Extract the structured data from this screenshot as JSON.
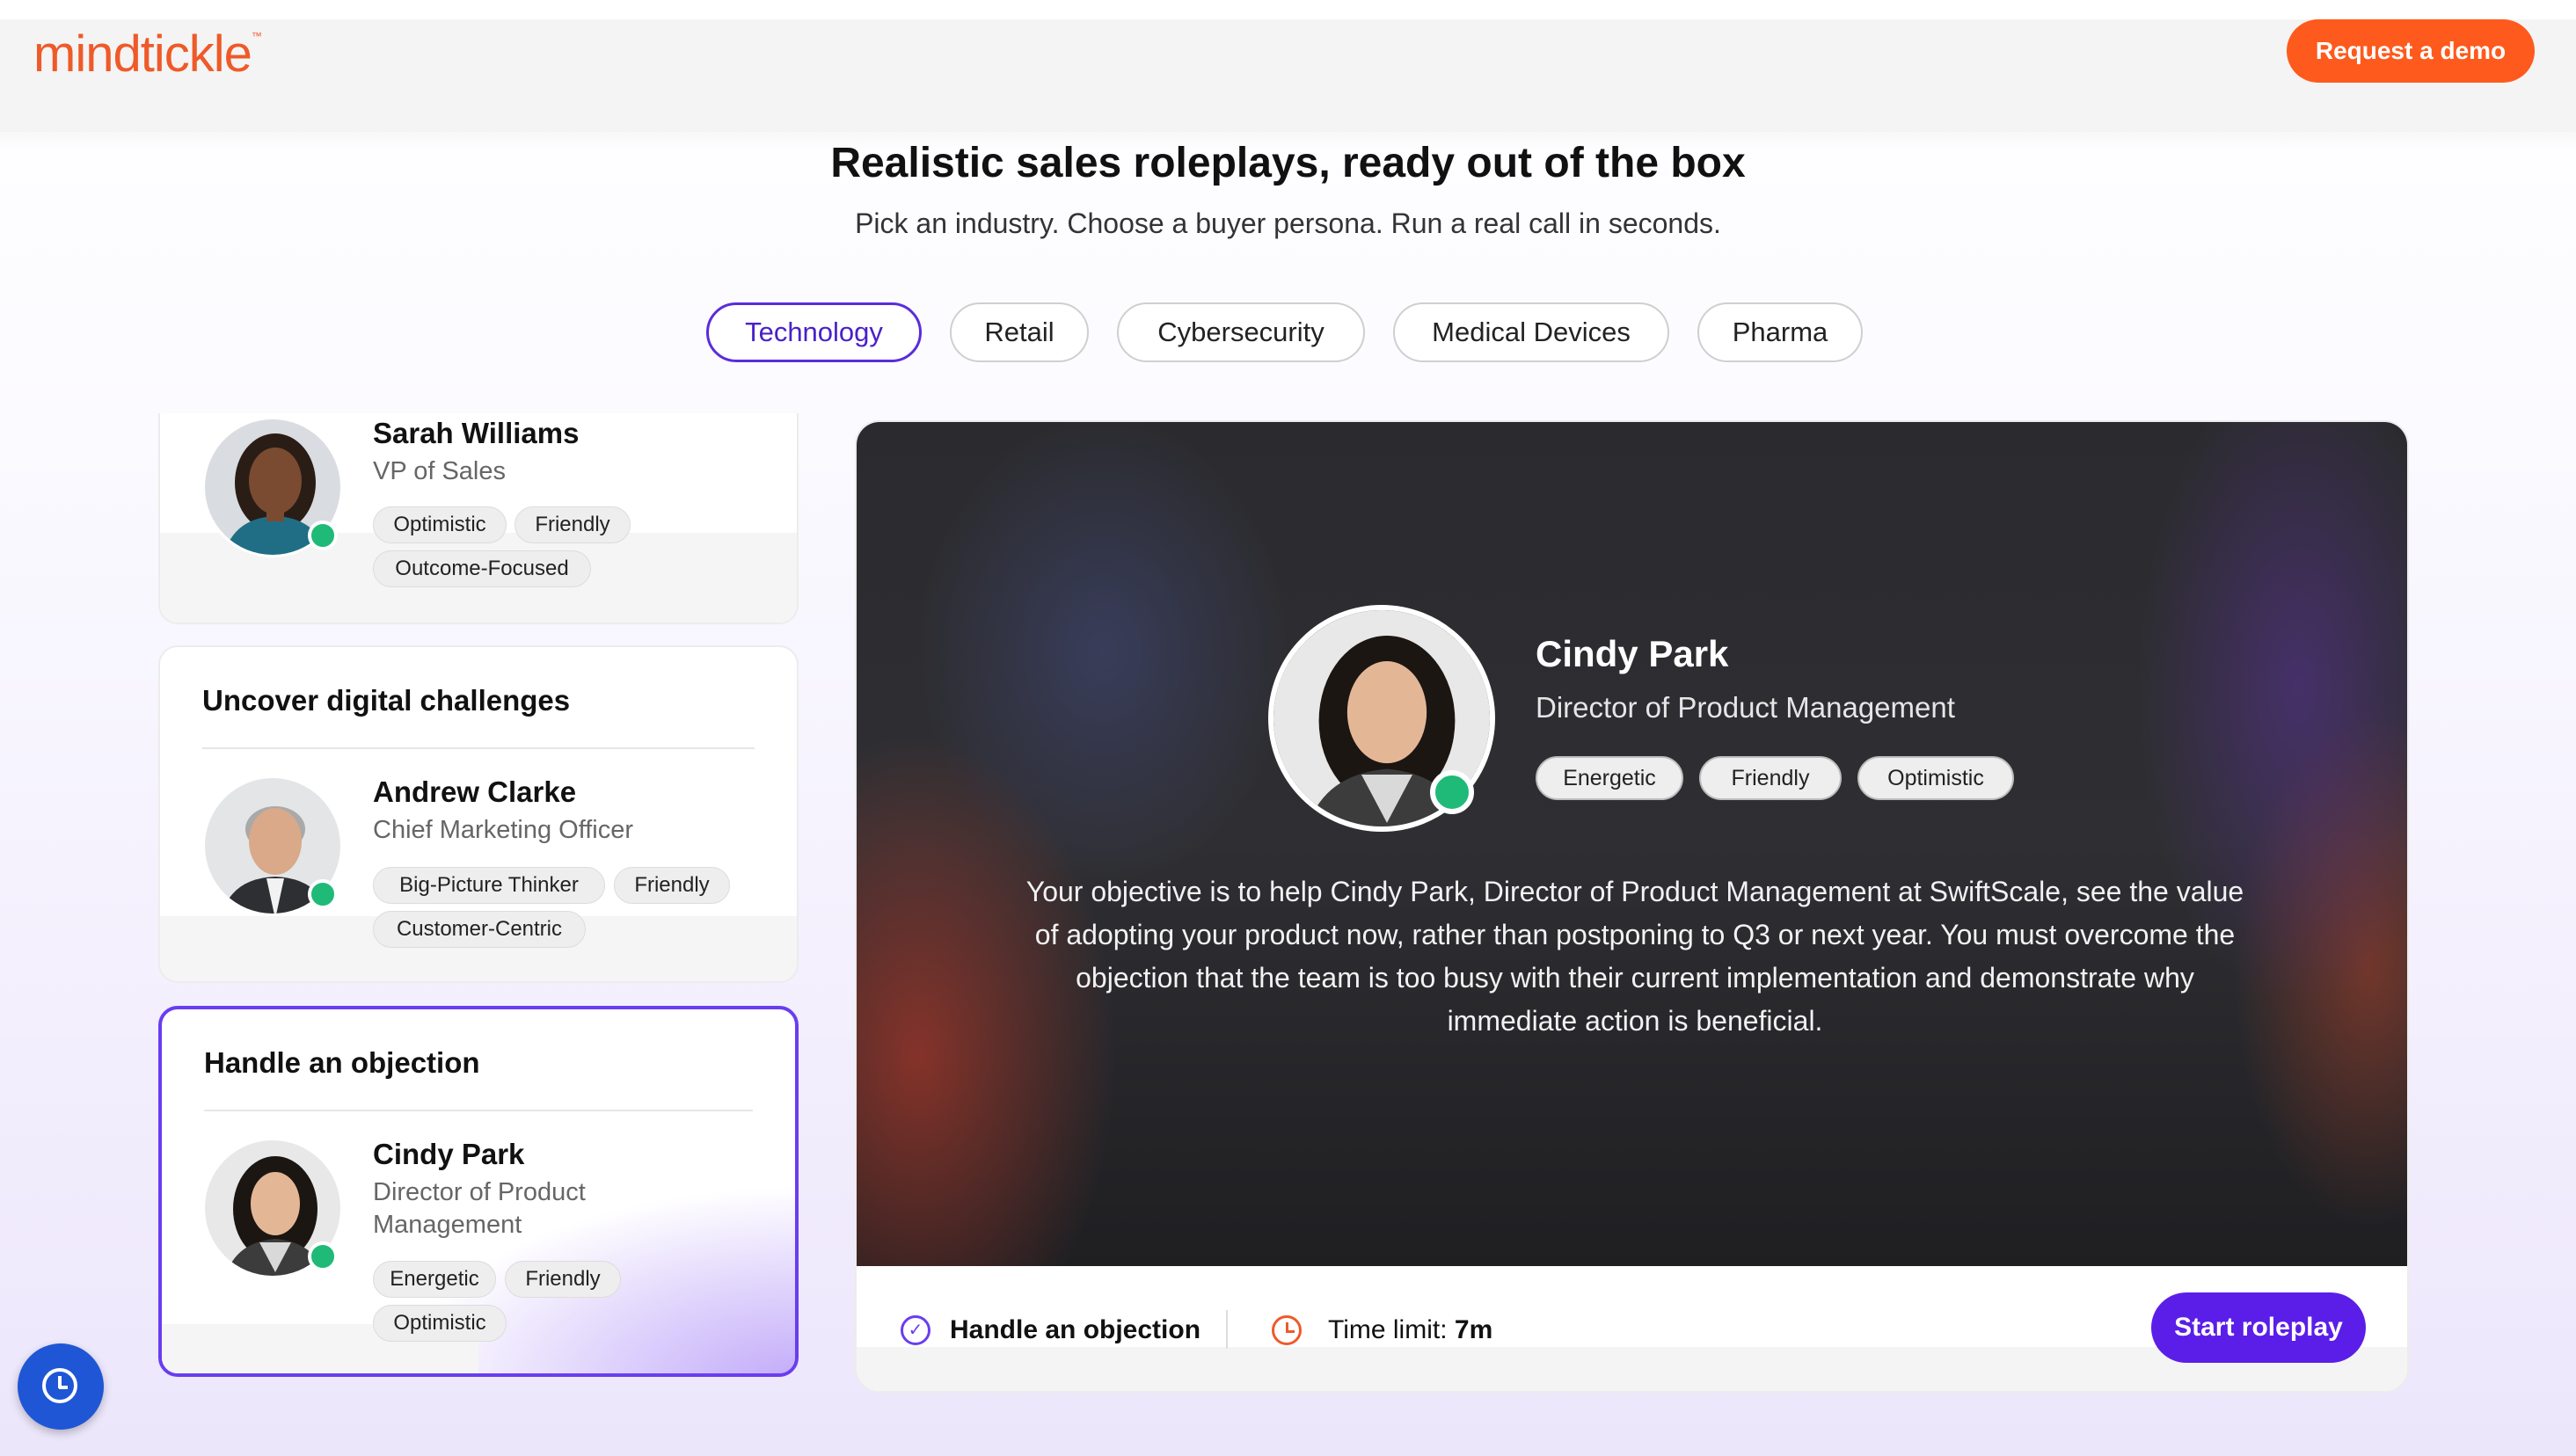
{
  "header": {
    "logo": "mindtickle",
    "logo_tm": "™",
    "demo_label": "Request a demo"
  },
  "hero": {
    "title": "Realistic sales roleplays, ready out of the box",
    "subtitle": "Pick an industry. Choose a buyer persona. Run a real call in seconds."
  },
  "tabs": [
    {
      "label": "Technology",
      "active": true
    },
    {
      "label": "Retail"
    },
    {
      "label": "Cybersecurity"
    },
    {
      "label": "Medical Devices"
    },
    {
      "label": "Pharma"
    }
  ],
  "scenarios": [
    {
      "name": "Sarah Williams",
      "role": "VP of Sales",
      "traits": [
        "Optimistic",
        "Friendly",
        "Outcome-Focused"
      ]
    },
    {
      "title": "Uncover digital challenges",
      "name": "Andrew Clarke",
      "role": "Chief Marketing Officer",
      "traits": [
        "Big-Picture Thinker",
        "Friendly",
        "Customer-Centric"
      ]
    },
    {
      "title": "Handle an objection",
      "name": "Cindy Park",
      "role_line1": "Director of Product",
      "role_line2": "Management",
      "traits": [
        "Energetic",
        "Friendly",
        "Optimistic"
      ],
      "selected": true
    }
  ],
  "detail": {
    "name": "Cindy Park",
    "role": "Director of Product Management",
    "traits": [
      "Energetic",
      "Friendly",
      "Optimistic"
    ],
    "objective": "Your objective is to help Cindy Park, Director of Product Management at SwiftScale, see the value of adopting your product now, rather than postponing to Q3 or next year. You must overcome the objection that the team is too busy with their current implementation and demonstrate why immediate action is beneficial.",
    "task": "Handle an objection",
    "time_label": "Time limit:",
    "time_value": "7m",
    "start_label": "Start roleplay"
  },
  "colors": {
    "brand": "#ee5a29",
    "accent": "#5b1ee8",
    "status_online": "#1fba77"
  }
}
